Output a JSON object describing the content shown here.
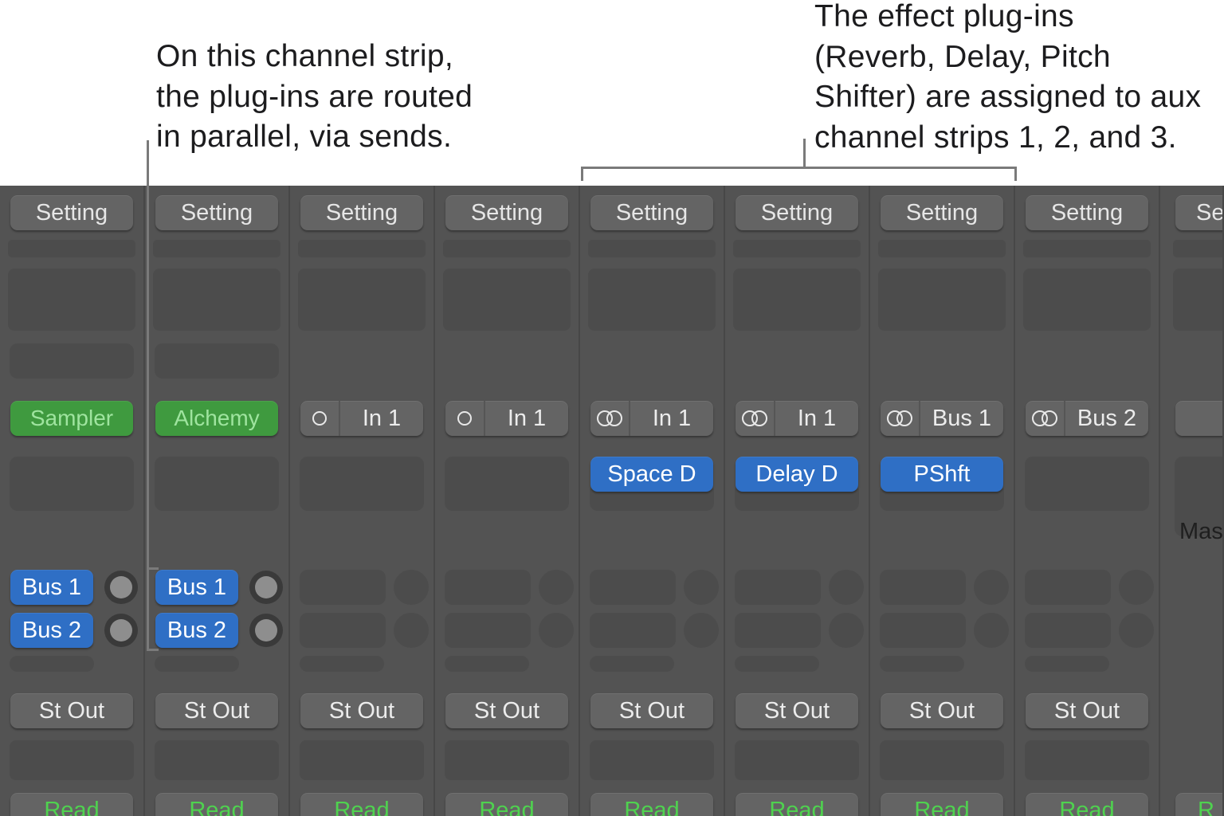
{
  "callouts": {
    "left": [
      "On this channel strip,",
      "the plug-ins are routed",
      "in parallel, via sends."
    ],
    "right": [
      "The effect plug-ins",
      "(Reverb, Delay, Pitch",
      "Shifter) are assigned to aux",
      "channel strips 1, 2, and 3."
    ]
  },
  "colors": {
    "mixer_bg": "#535353",
    "button_bg": "#646464",
    "instrument_green": "#3f9a3f",
    "plugin_blue": "#2f6fc5",
    "read_green": "#4fd24f"
  },
  "strips": [
    {
      "setting": "Setting",
      "instrument": "Sampler",
      "sends": [
        "Bus 1",
        "Bus 2"
      ],
      "output": "St Out",
      "automation": "Read"
    },
    {
      "setting": "Setting",
      "instrument": "Alchemy",
      "sends": [
        "Bus 1",
        "Bus 2"
      ],
      "output": "St Out",
      "automation": "Read"
    },
    {
      "setting": "Setting",
      "input_icon": "mono-circle-icon",
      "input": "In 1",
      "output": "St Out",
      "automation": "Read"
    },
    {
      "setting": "Setting",
      "input_icon": "mono-circle-icon",
      "input": "In 1",
      "output": "St Out",
      "automation": "Read"
    },
    {
      "setting": "Setting",
      "input_icon": "stereo-circles-icon",
      "input": "In 1",
      "plugin": "Space D",
      "output": "St Out",
      "automation": "Read"
    },
    {
      "setting": "Setting",
      "input_icon": "stereo-circles-icon",
      "input": "In 1",
      "plugin": "Delay D",
      "output": "St Out",
      "automation": "Read"
    },
    {
      "setting": "Setting",
      "input_icon": "stereo-circles-icon",
      "input": "Bus 1",
      "plugin": "PShft",
      "output": "St Out",
      "automation": "Read"
    },
    {
      "setting": "Setting",
      "input_icon": "stereo-circles-icon",
      "input": "Bus 2",
      "output": "St Out",
      "automation": "Read"
    },
    {
      "setting": "Se",
      "master_label": "Mas",
      "automation": "R"
    }
  ]
}
